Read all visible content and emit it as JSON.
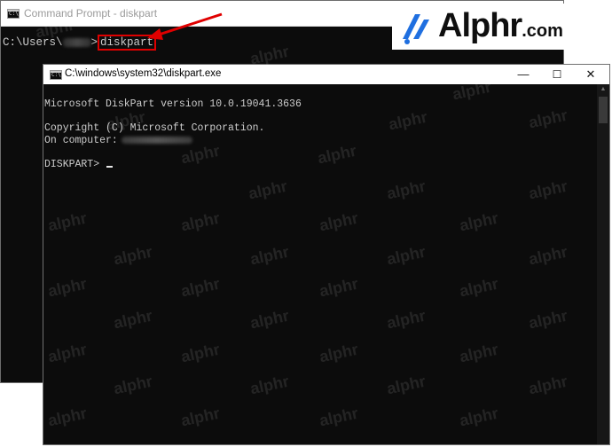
{
  "background_window": {
    "title": "Command Prompt - diskpart",
    "prompt_prefix": "C:\\Users\\",
    "prompt_suffix": ">",
    "command": "diskpart"
  },
  "logo": {
    "brand": "Alphr",
    "suffix": ".com"
  },
  "diskpart_window": {
    "title": "C:\\windows\\system32\\diskpart.exe",
    "lines": {
      "version": "Microsoft DiskPart version 10.0.19041.3636",
      "copyright": "Copyright (C) Microsoft Corporation.",
      "computer_label": "On computer:",
      "prompt": "DISKPART>"
    },
    "window_buttons": {
      "minimize": "—",
      "maximize": "☐",
      "close": "✕"
    }
  },
  "watermark_text": "alphr",
  "colors": {
    "console_bg": "#0c0c0c",
    "console_text": "#cccccc",
    "highlight": "#e00000",
    "logo_blue": "#1f6fe0"
  }
}
